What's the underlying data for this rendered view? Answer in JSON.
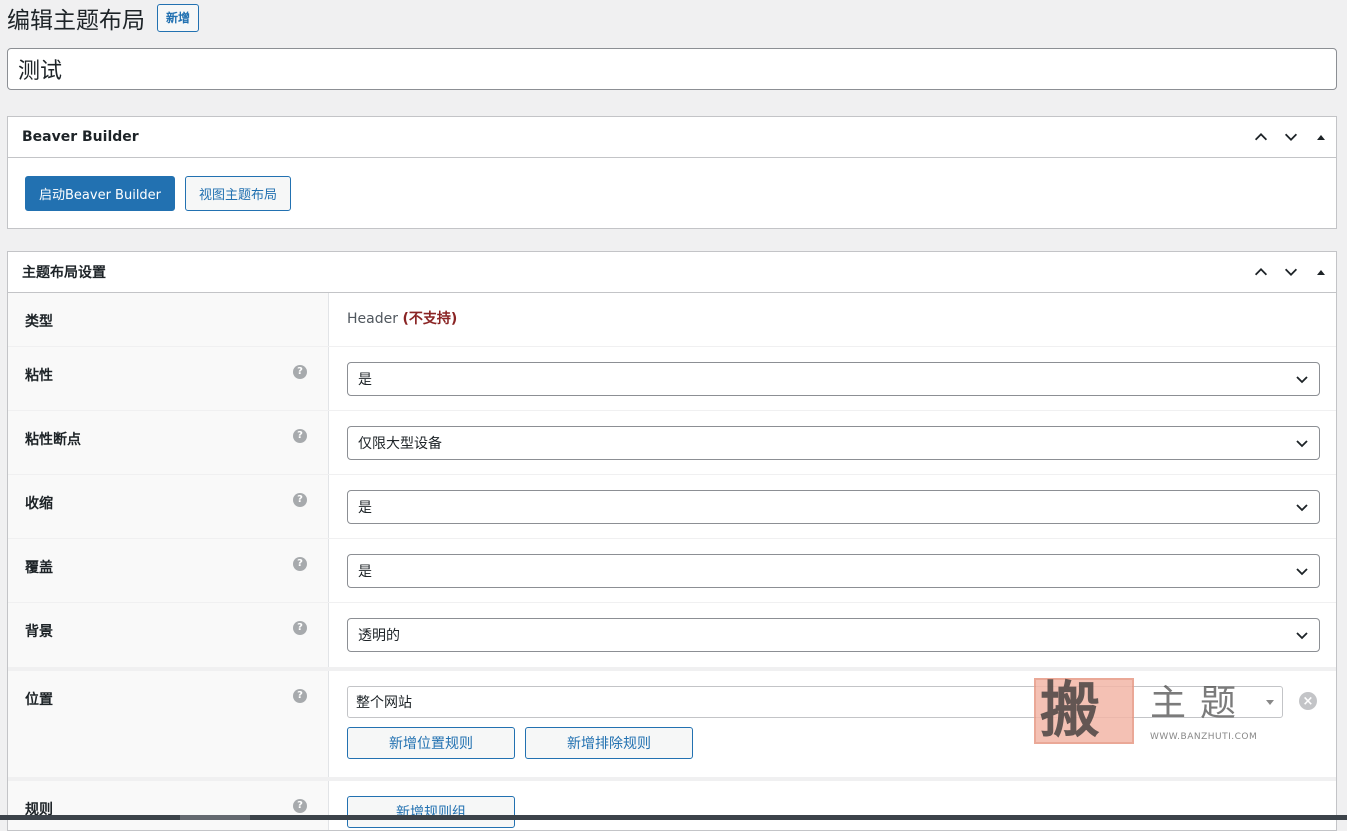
{
  "page": {
    "title": "编辑主题布局",
    "add_new": "新增",
    "post_title": "测试"
  },
  "beaver_box": {
    "title": "Beaver Builder",
    "launch_label": "启动Beaver Builder",
    "view_label": "视图主题布局"
  },
  "settings_box": {
    "title": "主题布局设置",
    "type_label": "类型",
    "type_value": "Header",
    "type_paren_open": "(",
    "type_unsupported": "不支持",
    "type_paren_close": ")",
    "rows": [
      {
        "label": "粘性",
        "value": "是"
      },
      {
        "label": "粘性断点",
        "value": "仅限大型设备"
      },
      {
        "label": "收缩",
        "value": "是"
      },
      {
        "label": "覆盖",
        "value": "是"
      },
      {
        "label": "背景",
        "value": "透明的"
      }
    ],
    "location": {
      "label": "位置",
      "value": "整个网站",
      "add_location_rule": "新增位置规则",
      "add_exclusion_rule": "新增排除规则"
    },
    "rules": {
      "label": "规则",
      "add_rule_group": "新增规则组"
    },
    "help_glyph": "?",
    "remove_glyph": "×"
  },
  "watermark": {
    "char_main": "搬",
    "chars": "主题",
    "url": "WWW.BANZHUTI.COM"
  },
  "icons": {
    "up": "chevron-up-icon",
    "down": "chevron-down-icon",
    "toggle": "triangle-up-icon",
    "help": "help-icon"
  },
  "colors": {
    "accent": "#2271b1",
    "unsupported": "#8a2424",
    "background": "#f0f0f1"
  }
}
